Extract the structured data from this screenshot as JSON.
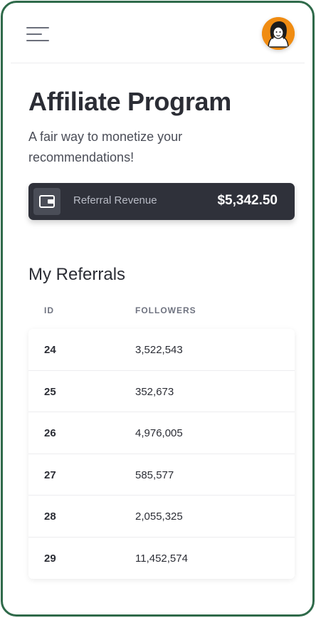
{
  "app": {
    "title": "Affiliate Program",
    "subtitle": "A fair way to monetize your recommendations!"
  },
  "header": {
    "menu_icon": "hamburger-menu-icon",
    "avatar_icon": "user-avatar"
  },
  "revenue": {
    "icon": "wallet-icon",
    "label": "Referral Revenue",
    "value": "$5,342.50"
  },
  "referrals": {
    "title": "My Referrals",
    "columns": [
      "ID",
      "FOLLOWERS"
    ],
    "rows": [
      {
        "id": "24",
        "followers": "3,522,543"
      },
      {
        "id": "25",
        "followers": "352,673"
      },
      {
        "id": "26",
        "followers": "4,976,005"
      },
      {
        "id": "27",
        "followers": "585,577"
      },
      {
        "id": "28",
        "followers": "2,055,325"
      },
      {
        "id": "29",
        "followers": "11,452,574"
      }
    ]
  },
  "colors": {
    "frame": "#2f6a4a",
    "card_bg": "#2f313a",
    "avatar_bg": "#f08c12"
  }
}
